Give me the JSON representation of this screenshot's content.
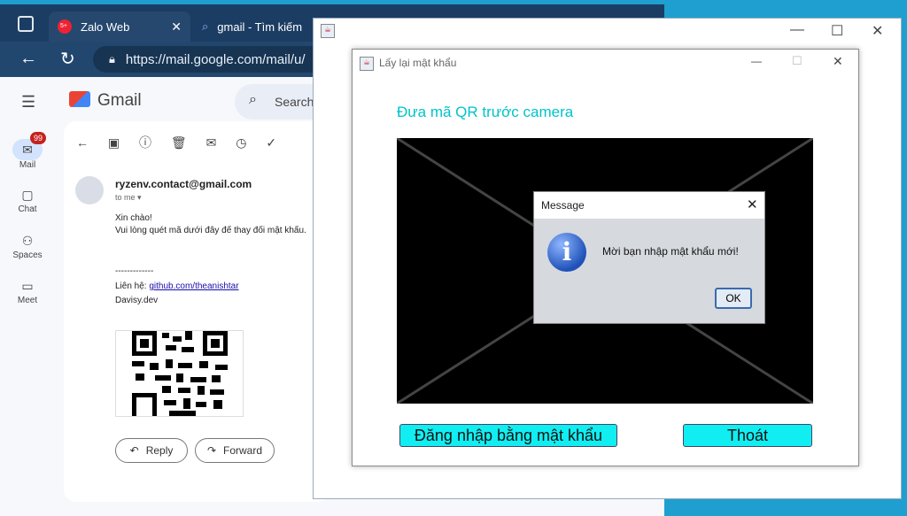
{
  "browser": {
    "tabs": [
      {
        "label": "Zalo Web",
        "badge": "5+"
      },
      {
        "label": "gmail - Tìm kiếm"
      }
    ],
    "url": "https://mail.google.com/mail/u/"
  },
  "gmail": {
    "logo_text": "Gmail",
    "search_placeholder": "Search",
    "rail": [
      {
        "label": "Mail",
        "badge": "99"
      },
      {
        "label": "Chat"
      },
      {
        "label": "Spaces"
      },
      {
        "label": "Meet"
      }
    ],
    "email": {
      "sender": "ryzenv.contact@gmail.com",
      "to": "to me",
      "greeting": "Xin chào!",
      "body": "Vui lòng quét mã dưới đây để thay đổi mật khẩu.",
      "separator": "-------------",
      "contact_label": "Liên hệ:",
      "contact_link": "github.com/theanishtar",
      "signature": "Davisy.dev"
    },
    "reply_label": "Reply",
    "forward_label": "Forward"
  },
  "qr_window": {
    "title": "Lấy lại mật khẩu",
    "heading": "Đưa mã QR trước camera",
    "login_button": "Đăng nhập bằng mật khẩu",
    "exit_button": "Thoát",
    "heading_color": "#00c3c9",
    "button_color": "#11eef2"
  },
  "message_dialog": {
    "title": "Message",
    "text": "Mời bạn nhập mật khẩu mới!",
    "ok_label": "OK"
  }
}
